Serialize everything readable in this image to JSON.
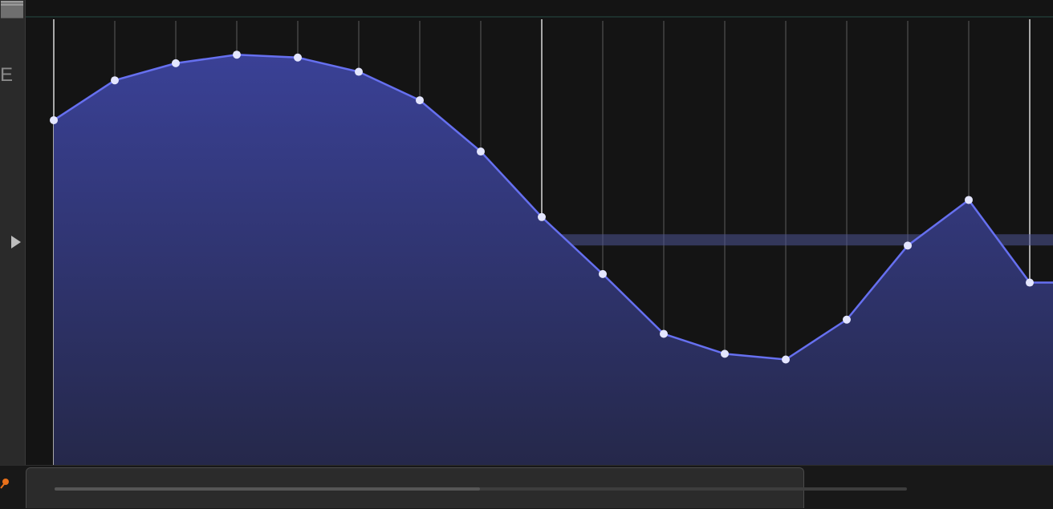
{
  "lane": {
    "label": "E"
  },
  "colors": {
    "curve": "#6670f0",
    "fill_top": "#3a4196",
    "fill_bottom": "#25284a",
    "point": "#e4e6ff",
    "grid": "#8b8b8b",
    "baseline_band": "#4c5394",
    "accent_pin": "#e8701a"
  },
  "chart_data": {
    "type": "line",
    "x": [
      0,
      1,
      2,
      3,
      4,
      5,
      6,
      7,
      8,
      9,
      10,
      11,
      12,
      13,
      14,
      15,
      16,
      17
    ],
    "values": [
      0.71,
      0.85,
      0.91,
      0.94,
      0.93,
      0.88,
      0.78,
      0.6,
      0.37,
      0.17,
      -0.04,
      -0.11,
      -0.13,
      0.01,
      0.27,
      0.43,
      0.14,
      0.14
    ],
    "ylim": [
      -0.5,
      1.07
    ],
    "baseline": 0.29,
    "last_point_style": "square",
    "grid": true
  },
  "scrollbar": {
    "position": 0.5
  }
}
